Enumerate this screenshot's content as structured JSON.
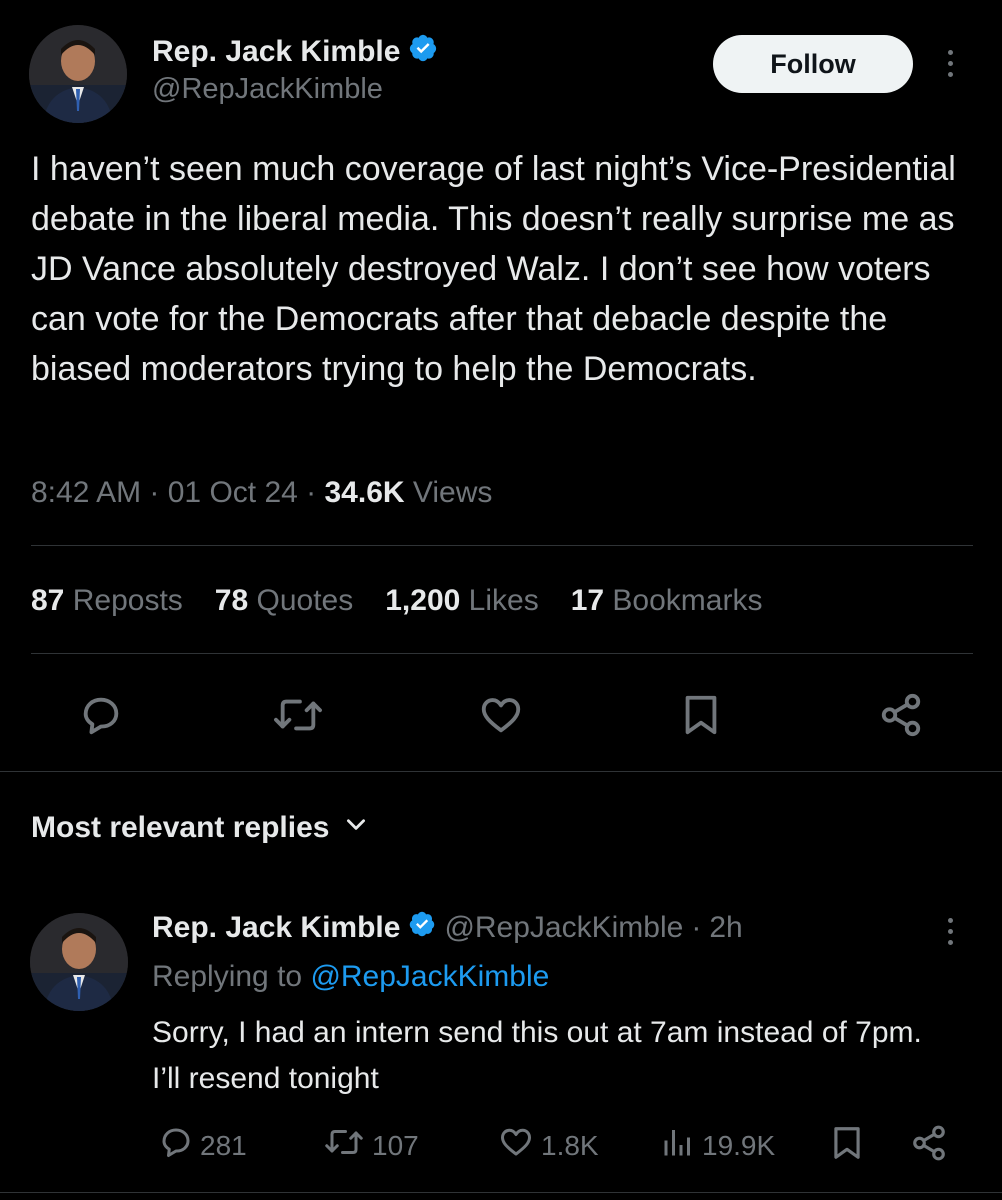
{
  "tweet": {
    "author": {
      "name": "Rep. Jack Kimble",
      "handle": "@RepJackKimble"
    },
    "follow_label": "Follow",
    "text": "I haven’t seen much coverage of last night’s Vice-Presidential debate in the liberal media. This doesn’t really surprise me as JD Vance absolutely destroyed Walz. I don’t see how voters can vote for the Democrats after that debacle despite the biased moderators trying to help the Democrats.",
    "time": "8:42 AM",
    "date": "01 Oct 24",
    "views_count": "34.6K",
    "views_label": "Views",
    "stats": [
      {
        "num": "87",
        "label": "Reposts"
      },
      {
        "num": "78",
        "label": "Quotes"
      },
      {
        "num": "1,200",
        "label": "Likes"
      },
      {
        "num": "17",
        "label": "Bookmarks"
      }
    ],
    "icons": [
      "reply-icon",
      "repost-icon",
      "like-icon",
      "bookmark-icon",
      "share-icon"
    ]
  },
  "replies_filter": {
    "label": "Most relevant replies"
  },
  "reply": {
    "author": {
      "name": "Rep. Jack Kimble",
      "handle": "@RepJackKimble"
    },
    "age": "2h",
    "replying_to_prefix": "Replying to",
    "replying_to_handle": "@RepJackKimble",
    "text": "Sorry, I had an intern send this out at 7am instead of 7pm. I’ll resend tonight",
    "actions": {
      "replies": "281",
      "reposts": "107",
      "likes": "1.8K",
      "views": "19.9K"
    }
  },
  "colors": {
    "background": "#000000",
    "text": "#e7e9ea",
    "muted": "#71767b",
    "link": "#1d9bf0",
    "verified": "#1d9bf0"
  }
}
